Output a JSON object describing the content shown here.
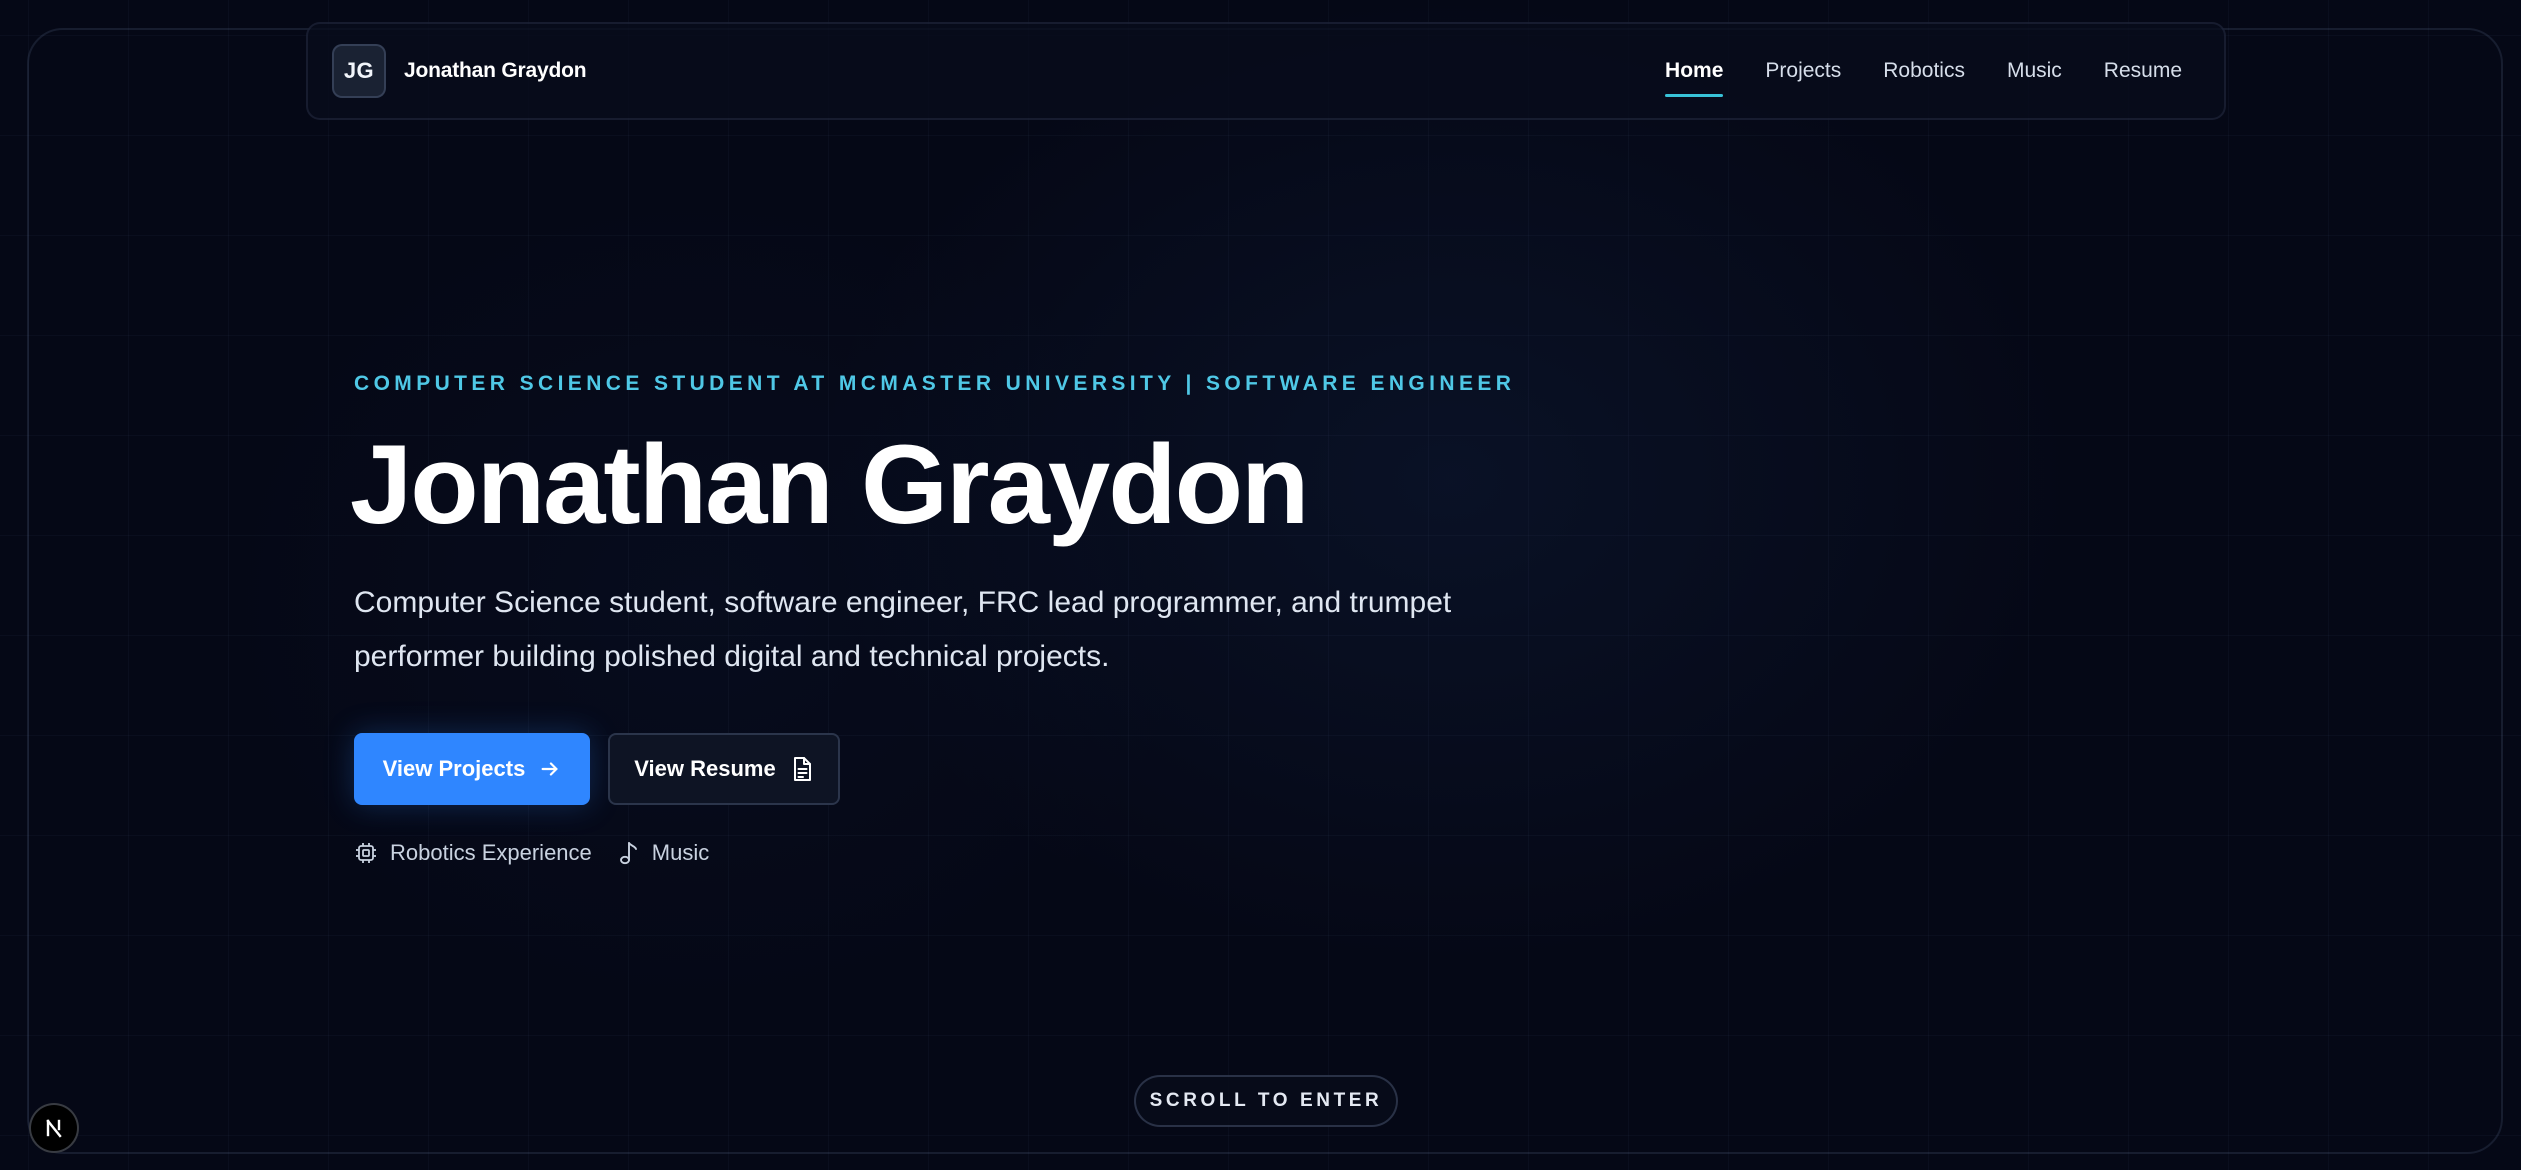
{
  "nav": {
    "brand_initials": "JG",
    "brand_name": "Jonathan Graydon",
    "links": [
      {
        "label": "Home",
        "active": true
      },
      {
        "label": "Projects",
        "active": false
      },
      {
        "label": "Robotics",
        "active": false
      },
      {
        "label": "Music",
        "active": false
      },
      {
        "label": "Resume",
        "active": false
      }
    ]
  },
  "hero": {
    "eyebrow": "COMPUTER SCIENCE STUDENT AT MCMASTER UNIVERSITY | SOFTWARE ENGINEER",
    "title": "Jonathan Graydon",
    "description": "Computer Science student, software engineer, FRC lead programmer, and trumpet performer building polished digital and technical projects.",
    "primary_button": {
      "label": "View Projects",
      "icon": "arrow-right-icon"
    },
    "secondary_button": {
      "label": "View Resume",
      "icon": "document-icon"
    },
    "chips": [
      {
        "label": "Robotics Experience",
        "icon": "chip-icon"
      },
      {
        "label": "Music",
        "icon": "music-note-icon"
      }
    ]
  },
  "scroll_prompt": "SCROLL TO ENTER",
  "dev_badge": {
    "icon": "nextjs-logo-icon"
  },
  "colors": {
    "background": "#050816",
    "accent_cyan": "#4fc8e6",
    "nav_underline": "#38c3d8",
    "primary_button": "#2f86ff"
  }
}
